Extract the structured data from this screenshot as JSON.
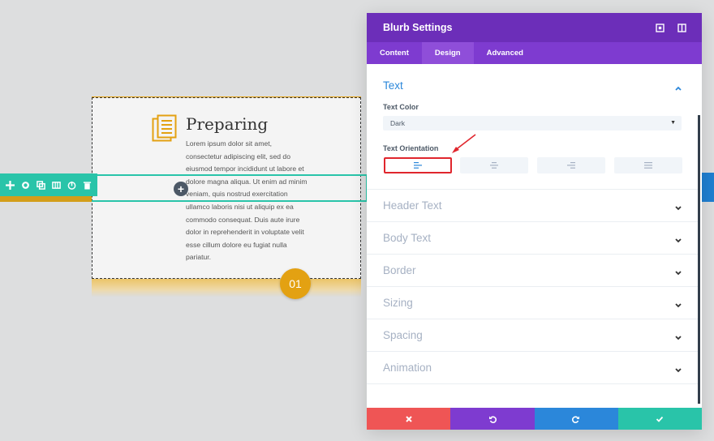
{
  "preview": {
    "blurb_title": "Preparing",
    "blurb_body": "Lorem ipsum dolor sit amet, consectetur adipiscing elit, sed do eiusmod tempor incididunt ut labore et dolore magna aliqua. Ut enim ad minim veniam, quis nostrud exercitation ullamco laboris nisi ut aliquip ex ea commodo consequat. Duis aute irure dolor in reprehenderit in voluptate velit esse cillum dolore eu fugiat nulla pariatur.",
    "number_badge": "01",
    "add_symbol": "+",
    "row_toolbar_icons": [
      "move-icon",
      "settings-icon",
      "duplicate-icon",
      "columns-icon",
      "save-icon",
      "delete-icon"
    ]
  },
  "modal": {
    "title": "Blurb Settings",
    "tabs": [
      {
        "label": "Content"
      },
      {
        "label": "Design"
      },
      {
        "label": "Advanced"
      }
    ],
    "active_tab": "Design",
    "text_section": {
      "title": "Text",
      "text_color_label": "Text Color",
      "text_color_value": "Dark",
      "orientation_label": "Text Orientation",
      "orientation_options": [
        "left",
        "center",
        "right",
        "justified"
      ],
      "orientation_selected": "left"
    },
    "sections": [
      {
        "title": "Header Text"
      },
      {
        "title": "Body Text"
      },
      {
        "title": "Border"
      },
      {
        "title": "Sizing"
      },
      {
        "title": "Spacing"
      },
      {
        "title": "Animation"
      }
    ],
    "footer_buttons": [
      "close-icon",
      "undo-icon",
      "redo-icon",
      "check-icon"
    ]
  },
  "colors": {
    "header_purple": "#6c2eb9",
    "tabs_purple": "#7e3bd0",
    "active_section_blue": "#2b87da",
    "row_teal": "#29c4a9",
    "accent_orange": "#e3a112",
    "cancel_red": "#ef5555",
    "undo_purple": "#7e3bd0",
    "redo_blue": "#2b87da",
    "save_green": "#29c4a9"
  }
}
